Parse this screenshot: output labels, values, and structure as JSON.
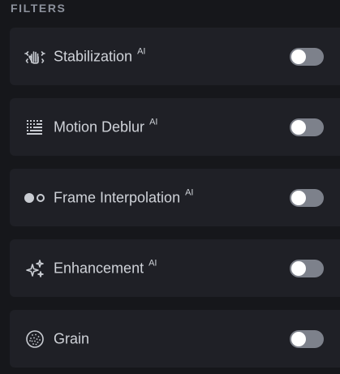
{
  "section": {
    "title": "FILTERS"
  },
  "filters": [
    {
      "label": "Stabilization",
      "badge": "AI",
      "icon": "hand-stabilization-icon",
      "enabled": false
    },
    {
      "label": "Motion Deblur",
      "badge": "AI",
      "icon": "motion-deblur-icon",
      "enabled": false
    },
    {
      "label": "Frame Interpolation",
      "badge": "AI",
      "icon": "frame-interpolation-icon",
      "enabled": false
    },
    {
      "label": "Enhancement",
      "badge": "AI",
      "icon": "sparkle-icon",
      "enabled": false
    },
    {
      "label": "Grain",
      "badge": "",
      "icon": "grain-icon",
      "enabled": false
    }
  ],
  "colors": {
    "background": "#16171b",
    "row_background": "#1f2026",
    "toggle_off": "#7d818b",
    "text": "#cfd2d8"
  }
}
